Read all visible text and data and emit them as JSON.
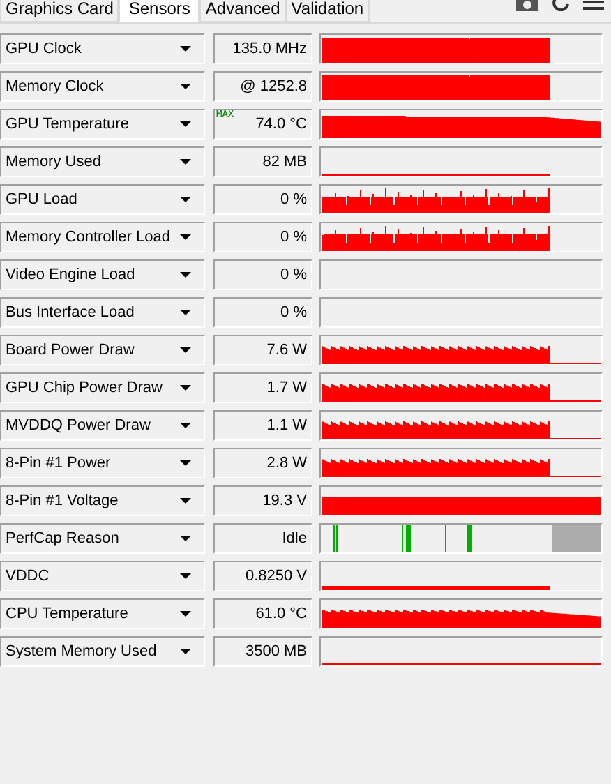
{
  "tabs": [
    {
      "label": "Graphics Card",
      "selected": false
    },
    {
      "label": "Sensors",
      "selected": true
    },
    {
      "label": "Advanced",
      "selected": false
    },
    {
      "label": "Validation",
      "selected": false
    }
  ],
  "sensors": [
    {
      "name": "GPU Clock",
      "value": "135.0 MHz",
      "kind": "clock"
    },
    {
      "name": "Memory Clock",
      "value": "@ 1252.8",
      "kind": "clock"
    },
    {
      "name": "GPU Temperature",
      "value": "74.0 °C",
      "badge": "MAX",
      "kind": "temp"
    },
    {
      "name": "Memory Used",
      "value": "82 MB",
      "kind": "used"
    },
    {
      "name": "GPU Load",
      "value": "0 %",
      "kind": "load"
    },
    {
      "name": "Memory Controller Load",
      "value": "0 %",
      "kind": "load"
    },
    {
      "name": "Video Engine Load",
      "value": "0 %",
      "kind": "zero"
    },
    {
      "name": "Bus Interface Load",
      "value": "0 %",
      "kind": "zero"
    },
    {
      "name": "Board Power Draw",
      "value": "7.6 W",
      "kind": "power"
    },
    {
      "name": "GPU Chip Power Draw",
      "value": "1.7 W",
      "kind": "power"
    },
    {
      "name": "MVDDQ Power Draw",
      "value": "1.1 W",
      "kind": "power"
    },
    {
      "name": "8-Pin #1 Power",
      "value": "2.8 W",
      "kind": "power"
    },
    {
      "name": "8-Pin #1 Voltage",
      "value": "19.3 V",
      "kind": "voltage"
    },
    {
      "name": "PerfCap Reason",
      "value": "Idle",
      "kind": "perfcap"
    },
    {
      "name": "VDDC",
      "value": "0.8250 V",
      "kind": "vddc"
    },
    {
      "name": "CPU Temperature",
      "value": "61.0 °C",
      "kind": "cpu"
    },
    {
      "name": "System Memory Used",
      "value": "3500 MB",
      "kind": "sysmem"
    }
  ]
}
